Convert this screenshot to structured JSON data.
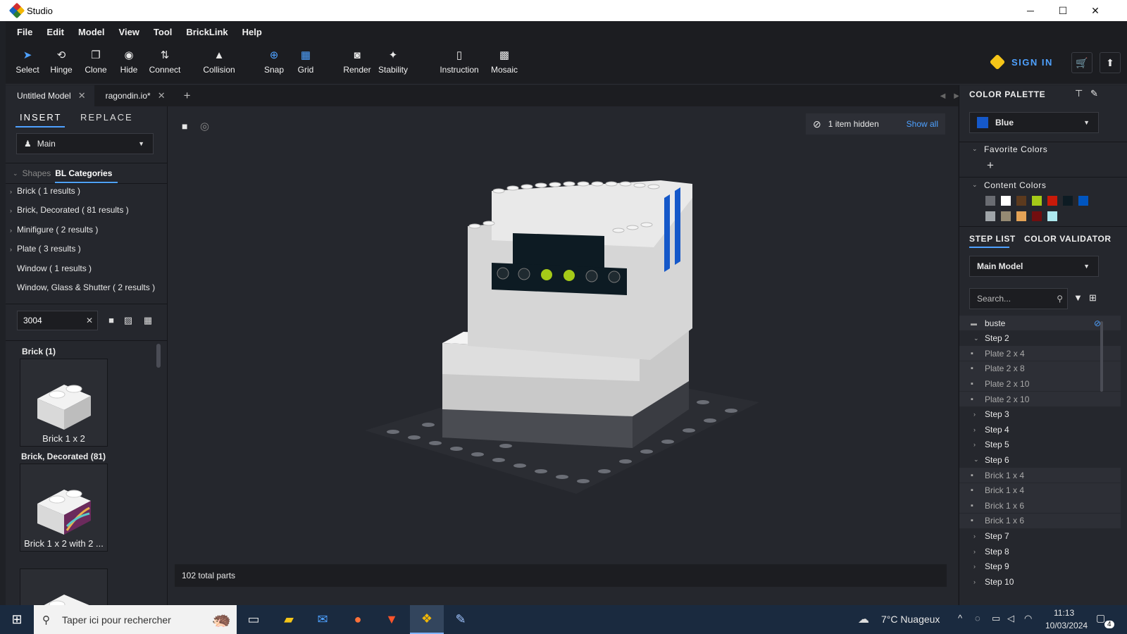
{
  "window": {
    "title": "Studio",
    "min": "─",
    "max": "☐",
    "close": "✕"
  },
  "menu": [
    "File",
    "Edit",
    "Model",
    "View",
    "Tool",
    "BrickLink",
    "Help"
  ],
  "tools": [
    {
      "label": "Select",
      "icon": "➤"
    },
    {
      "label": "Hinge",
      "icon": "⟲"
    },
    {
      "label": "Clone",
      "icon": "❐"
    },
    {
      "label": "Hide",
      "icon": "◉"
    },
    {
      "label": "Connect",
      "icon": "⇅"
    },
    {
      "label": "Collision",
      "icon": "▲"
    },
    {
      "label": "Snap",
      "icon": "⊕"
    },
    {
      "label": "Grid",
      "icon": "▦"
    },
    {
      "label": "Render",
      "icon": "◙"
    },
    {
      "label": "Stability",
      "icon": "✦"
    },
    {
      "label": "Instruction",
      "icon": "▯"
    },
    {
      "label": "Mosaic",
      "icon": "▩"
    }
  ],
  "account": {
    "signin": "SIGN IN",
    "cart_icon": "cart-icon",
    "upload_icon": "upload-icon"
  },
  "tabs": [
    {
      "label": "Untitled Model"
    },
    {
      "label": "ragondin.io*"
    }
  ],
  "left": {
    "tab_insert": "INSERT",
    "tab_replace": "REPLACE",
    "palette_select": "Main",
    "shapes": "Shapes",
    "bl_categories": "BL Categories",
    "categories": [
      "Brick ( 1 results )",
      "Brick, Decorated ( 81 results )",
      "Minifigure ( 2 results )",
      "Plate ( 3 results )",
      "Window ( 1 results )",
      "Window, Glass & Shutter ( 2 results )"
    ],
    "search_value": "3004",
    "groups": [
      {
        "header": "Brick (1)",
        "part": "Brick 1 x 2"
      },
      {
        "header": "Brick, Decorated (81)",
        "part": "Brick 1 x 2 with 2 ..."
      }
    ]
  },
  "viewport": {
    "hidden_text": "1 item hidden",
    "show_all": "Show all",
    "total_parts": "102 total parts"
  },
  "right": {
    "palette_title": "COLOR PALETTE",
    "selected_color": "Blue",
    "selected_hex": "#1558c9",
    "favorite": "Favorite Colors",
    "add": "+",
    "content": "Content Colors",
    "content_colors": [
      "#6a6c72",
      "#ffffff",
      "#5c3a1e",
      "#a5ca18",
      "#c91a09",
      "#0d1b23",
      "#0055bf",
      "#a0a5a9",
      "#958a73",
      "#e4a356",
      "#720e0f",
      "#aee9ef"
    ],
    "tab_steps": "STEP LIST",
    "tab_validator": "COLOR VALIDATOR",
    "model_select": "Main Model",
    "search_placeholder": "Search...",
    "steps": [
      {
        "label": "buste",
        "kind": "folder"
      },
      {
        "label": "Step 2",
        "kind": "open"
      },
      {
        "label": "Plate 2 x 4",
        "kind": "part"
      },
      {
        "label": "Plate 2 x 8",
        "kind": "part"
      },
      {
        "label": "Plate 2 x 10",
        "kind": "part"
      },
      {
        "label": "Plate 2 x 10",
        "kind": "part"
      },
      {
        "label": "Step 3",
        "kind": "closed"
      },
      {
        "label": "Step 4",
        "kind": "closed"
      },
      {
        "label": "Step 5",
        "kind": "closed"
      },
      {
        "label": "Step 6",
        "kind": "open"
      },
      {
        "label": "Brick 1 x 4",
        "kind": "part"
      },
      {
        "label": "Brick 1 x 4",
        "kind": "part"
      },
      {
        "label": "Brick 1 x 6",
        "kind": "part"
      },
      {
        "label": "Brick 1 x 6",
        "kind": "part"
      },
      {
        "label": "Step 7",
        "kind": "closed"
      },
      {
        "label": "Step 8",
        "kind": "closed"
      },
      {
        "label": "Step 9",
        "kind": "closed"
      },
      {
        "label": "Step 10",
        "kind": "closed"
      }
    ]
  },
  "taskbar": {
    "search_placeholder": "Taper ici pour rechercher",
    "weather": "7°C  Nuageux",
    "time": "11:13",
    "date": "10/03/2024",
    "notif": "4"
  }
}
